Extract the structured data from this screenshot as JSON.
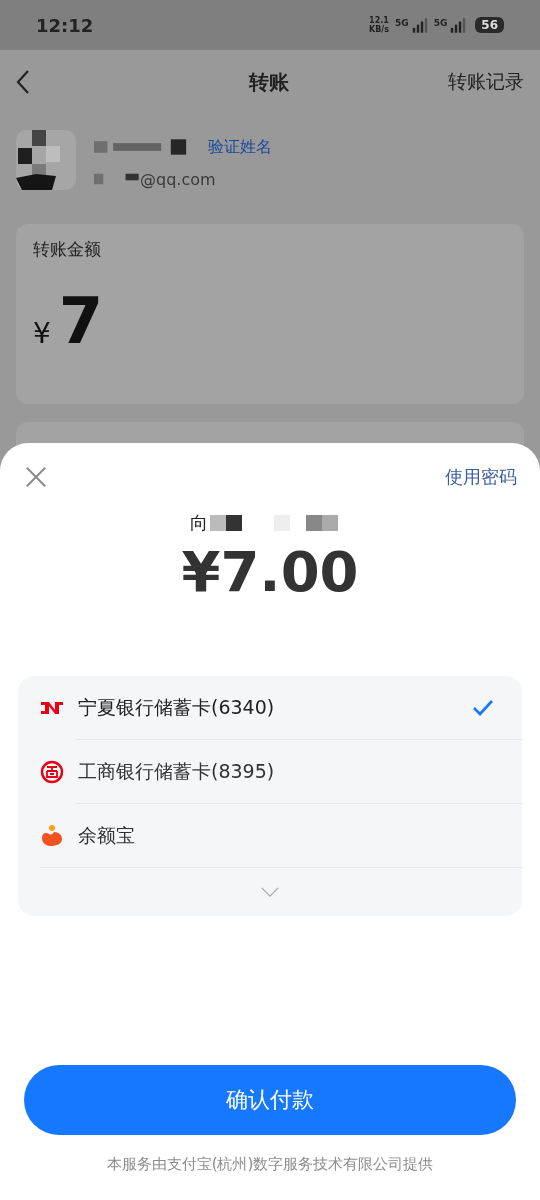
{
  "status_bar": {
    "time": "12:12",
    "speed_value": "12.1",
    "speed_unit": "KB/s",
    "networks": [
      "5G",
      "5G"
    ],
    "battery": "56"
  },
  "header": {
    "title": "转账",
    "records_link": "转账记录"
  },
  "recipient": {
    "verify_link": "验证姓名",
    "email_tail": "@qq.com"
  },
  "amount_card": {
    "label": "转账金额",
    "currency": "¥",
    "amount": "7"
  },
  "sheet": {
    "password_link": "使用密码",
    "payee_prefix": "向",
    "amount": "¥7.00",
    "methods": [
      {
        "kind": "nx-bank",
        "name": "宁夏银行储蓄卡(6340)",
        "selected": true
      },
      {
        "kind": "icbc",
        "name": "工商银行储蓄卡(8395)",
        "selected": false
      },
      {
        "kind": "yuebao",
        "name": "余额宝",
        "selected": false
      }
    ],
    "confirm_button": "确认付款",
    "footer": "本服务由支付宝(杭州)数字服务技术有限公司提供"
  }
}
